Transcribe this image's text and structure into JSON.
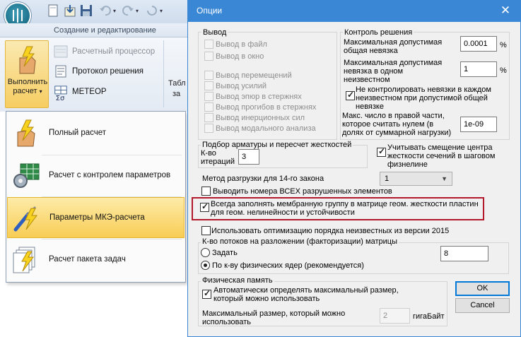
{
  "ribbon": {
    "group_label": "Создание и редактирование",
    "run_button_label": "Выполнить расчет",
    "run_caret": "▾",
    "items": [
      {
        "label": "Расчетный процессор",
        "disabled": true
      },
      {
        "label": "Протокол решения",
        "disabled": false
      },
      {
        "label": "МЕТЕОР",
        "disabled": false
      }
    ],
    "next_group": {
      "line1": "Табл",
      "line2": "за"
    }
  },
  "menu": {
    "items": [
      {
        "label": "Полный расчет",
        "icon": "lightning-hand-icon"
      },
      {
        "label": "Расчет с контролем параметров",
        "icon": "gear-table-icon"
      },
      {
        "label": "Параметры МКЭ-расчета",
        "icon": "screwdriver-lightning-icon"
      },
      {
        "label": "Расчет пакета задач",
        "icon": "pages-lightning-icon"
      }
    ]
  },
  "dialog": {
    "title": "Опции",
    "close_glyph": "✕",
    "output_group": {
      "title": "Вывод",
      "items": [
        "Вывод в файл",
        "Вывод в окно",
        "Вывод перемещений",
        "Вывод усилий",
        "Вывод эпюр в стержнях",
        "Вывод прогибов в стержнях",
        "Вывод инерционных сил",
        "Вывод модального анализа"
      ]
    },
    "control_group": {
      "title": "Контроль решения",
      "max_residual_total_label": "Максимальная допустимая общая невязка",
      "max_residual_total_value": "0.0001",
      "max_residual_single_label": "Максимальная допустимая невязка в одном неизвестном",
      "max_residual_single_value": "1",
      "percent": "%",
      "no_control_label": "Не контролировать невязки в каждом неизвестном при допустимой общей невязке",
      "max_zero_label": "Макс. число в правой части, которое считать нулем (в долях от суммарной нагрузки)",
      "max_zero_value": "1e-09"
    },
    "rebar_group": {
      "title": "Подбор арматуры и пересчет жесткостей",
      "iterations_label": "К-во итераций",
      "iterations_value": "3"
    },
    "account_shear_label": "Учитывать смещение центра жесткости сечений в шаговом физнелине",
    "unload_method_label": "Метод разгрузки для 14-го закона",
    "unload_method_value": "1",
    "print_destroyed_label": "Выводить номера ВСЕХ разрушенных элементов",
    "membrane_label": "Всегда заполнять мембранную группу в матрице геом. жесткости пластин для геом. нелинейности и устойчивости",
    "optimization_label": "Использовать оптимизацию порядка неизвестных из версии 2015",
    "threads_group": {
      "title": "К-во потоков на разложении (факторизации) матрицы",
      "set_label": "Задать",
      "set_value": "8",
      "cores_label": "По к-ву физических ядер (рекомендуется)"
    },
    "memory_group": {
      "title": "Физическая память",
      "auto_label": "Автоматически определять максимальный размер, который можно использовать",
      "max_size_label": "Максимальный размер, который можно использовать",
      "max_size_value": "2",
      "unit": "гигаБайт"
    },
    "ok_label": "OK",
    "cancel_label": "Cancel"
  }
}
